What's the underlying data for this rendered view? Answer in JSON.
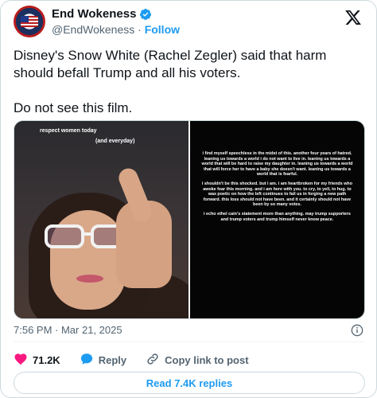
{
  "author": {
    "name": "End Wokeness",
    "handle": "@EndWokeness",
    "separator": "·",
    "follow_label": "Follow"
  },
  "tweet": {
    "text_line1": "Disney's Snow White (Rachel Zegler) said that harm should befall Trump and all his voters.",
    "text_line2": "Do not see this film."
  },
  "media": {
    "left_caption1": "respect women today",
    "left_caption2": "(and everyday)",
    "right_paragraphs": [
      "i find myself speechless in the midst of this. another four years of hatred. leaning us towards a world i do not want to live in. leaning us towards a world that will be hard to raise my daughter in. leaning us towards a world that will force her to have a baby she doesn't want. leaning us towards a world that is fearful.",
      "i shouldn't be this shocked. but i am. i am heartbroken for my friends who awoke fear this morning. and i am here with you. to cry, to yell, to hug. to wax poetic on how the left continues to fail us in forging a new path forward. this loss should not have been. and it certainly should not have been by so many votes.",
      "i echo ethel cain's statement more than anything. may trump supporters and trump voters and trump himself never know peace."
    ]
  },
  "meta": {
    "timestamp": "7:56 PM · Mar 21, 2025"
  },
  "actions": {
    "likes": "71.2K",
    "reply_label": "Reply",
    "copy_label": "Copy link to post"
  },
  "replies_button": {
    "label": "Read 7.4K replies"
  },
  "colors": {
    "accent": "#1d9bf0",
    "like": "#f91880",
    "text": "#0f1419",
    "muted": "#536471"
  },
  "icons": [
    "verified-badge-icon",
    "x-logo-icon",
    "info-icon",
    "heart-icon",
    "reply-bubble-icon",
    "link-icon"
  ]
}
